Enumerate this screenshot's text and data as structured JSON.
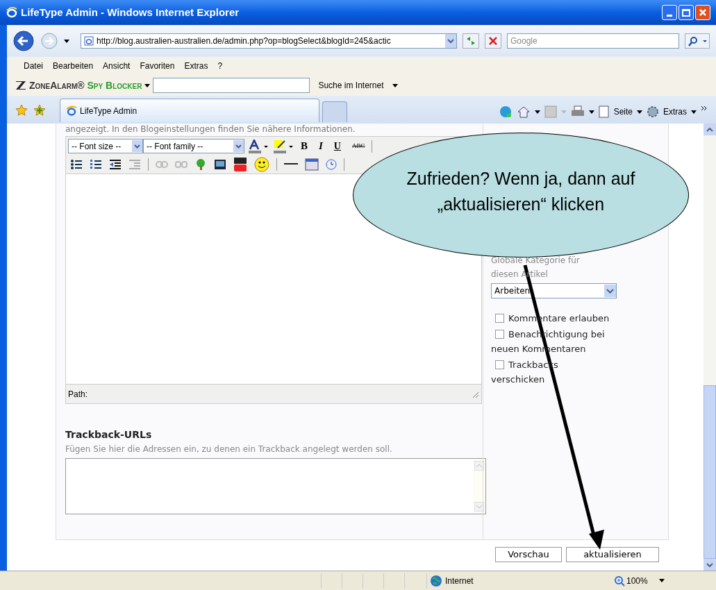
{
  "window": {
    "title": "LifeType Admin - Windows Internet Explorer"
  },
  "address_bar": {
    "url": "http://blog.australien-australien.de/admin.php?op=blogSelect&blogId=245&actic"
  },
  "search": {
    "placeholder": "Google"
  },
  "menu": [
    "Datei",
    "Bearbeiten",
    "Ansicht",
    "Favoriten",
    "Extras",
    "?"
  ],
  "zonealarm_toolbar": {
    "brand": "ZoneAlarm®",
    "product": "Spy Blocker",
    "search_label": "Suche im Internet"
  },
  "tabs": [
    {
      "label": "LifeType Admin",
      "selected": true
    },
    {
      "selected": false
    }
  ],
  "command_bar": [
    "Seite",
    "Extras"
  ],
  "page": {
    "intro": "angezeigt. In den Blogeinstellungen finden Sie nähere Informationen.",
    "editor": {
      "font_size": "-- Font size --",
      "font_family": "-- Font family --",
      "format_buttons": [
        "B",
        "I",
        "U",
        "ABC"
      ],
      "path_label": "Path:"
    },
    "trackback": {
      "heading": "Trackback-URLs",
      "hint": "Fügen Sie hier die Adressen ein, zu denen ein Trackback angelegt werden soll."
    },
    "sidebar": {
      "category_hint": "Globale Kategorie für diesen Artikel",
      "category": "Arbeiten",
      "options": [
        {
          "label": "Kommentare erlauben",
          "checked": false
        },
        {
          "label": "Benachrichtigung bei neuen Kommentaren",
          "checked": false
        },
        {
          "label": "Trackbacks verschicken",
          "checked": false
        }
      ]
    },
    "buttons": [
      "Vorschau",
      "aktualisieren"
    ]
  },
  "status_bar": {
    "zone": "Internet",
    "zoom": "100%"
  },
  "callout": {
    "lines": [
      "Zufrieden? Wenn ja, dann auf",
      "„aktualisieren“ klicken"
    ]
  }
}
